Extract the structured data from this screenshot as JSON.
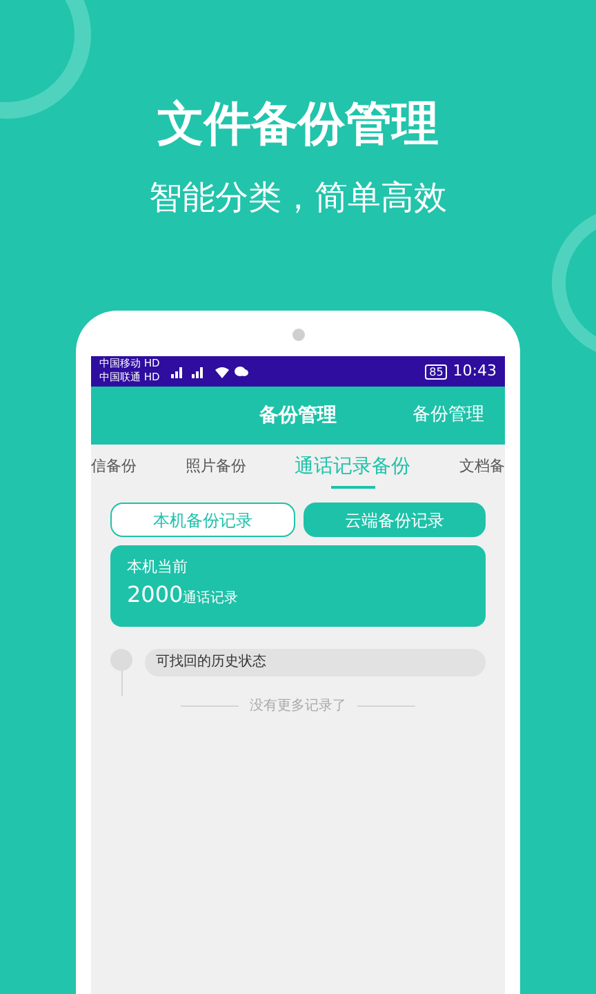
{
  "promo": {
    "title": "文件备份管理",
    "subtitle": "智能分类，简单高效"
  },
  "status_bar": {
    "carriers": [
      {
        "name": "中国移动",
        "badge": "HD"
      },
      {
        "name": "中国联通",
        "badge": "HD"
      }
    ],
    "battery": "85",
    "time": "10:43"
  },
  "header": {
    "title": "备份管理",
    "action": "备份管理"
  },
  "tabs": [
    {
      "label": "信备份",
      "selected": false
    },
    {
      "label": "照片备份",
      "selected": false
    },
    {
      "label": "通话记录备份",
      "selected": true
    },
    {
      "label": "文档备",
      "selected": false
    }
  ],
  "record_toggle": [
    {
      "label": "本机备份记录",
      "selected": true
    },
    {
      "label": "云端备份记录",
      "selected": false
    }
  ],
  "summary": {
    "label": "本机当前",
    "count": "2000",
    "unit": "通话记录"
  },
  "timeline": [
    {
      "text": "可找回的历史状态"
    }
  ],
  "end_note": "没有更多记录了"
}
